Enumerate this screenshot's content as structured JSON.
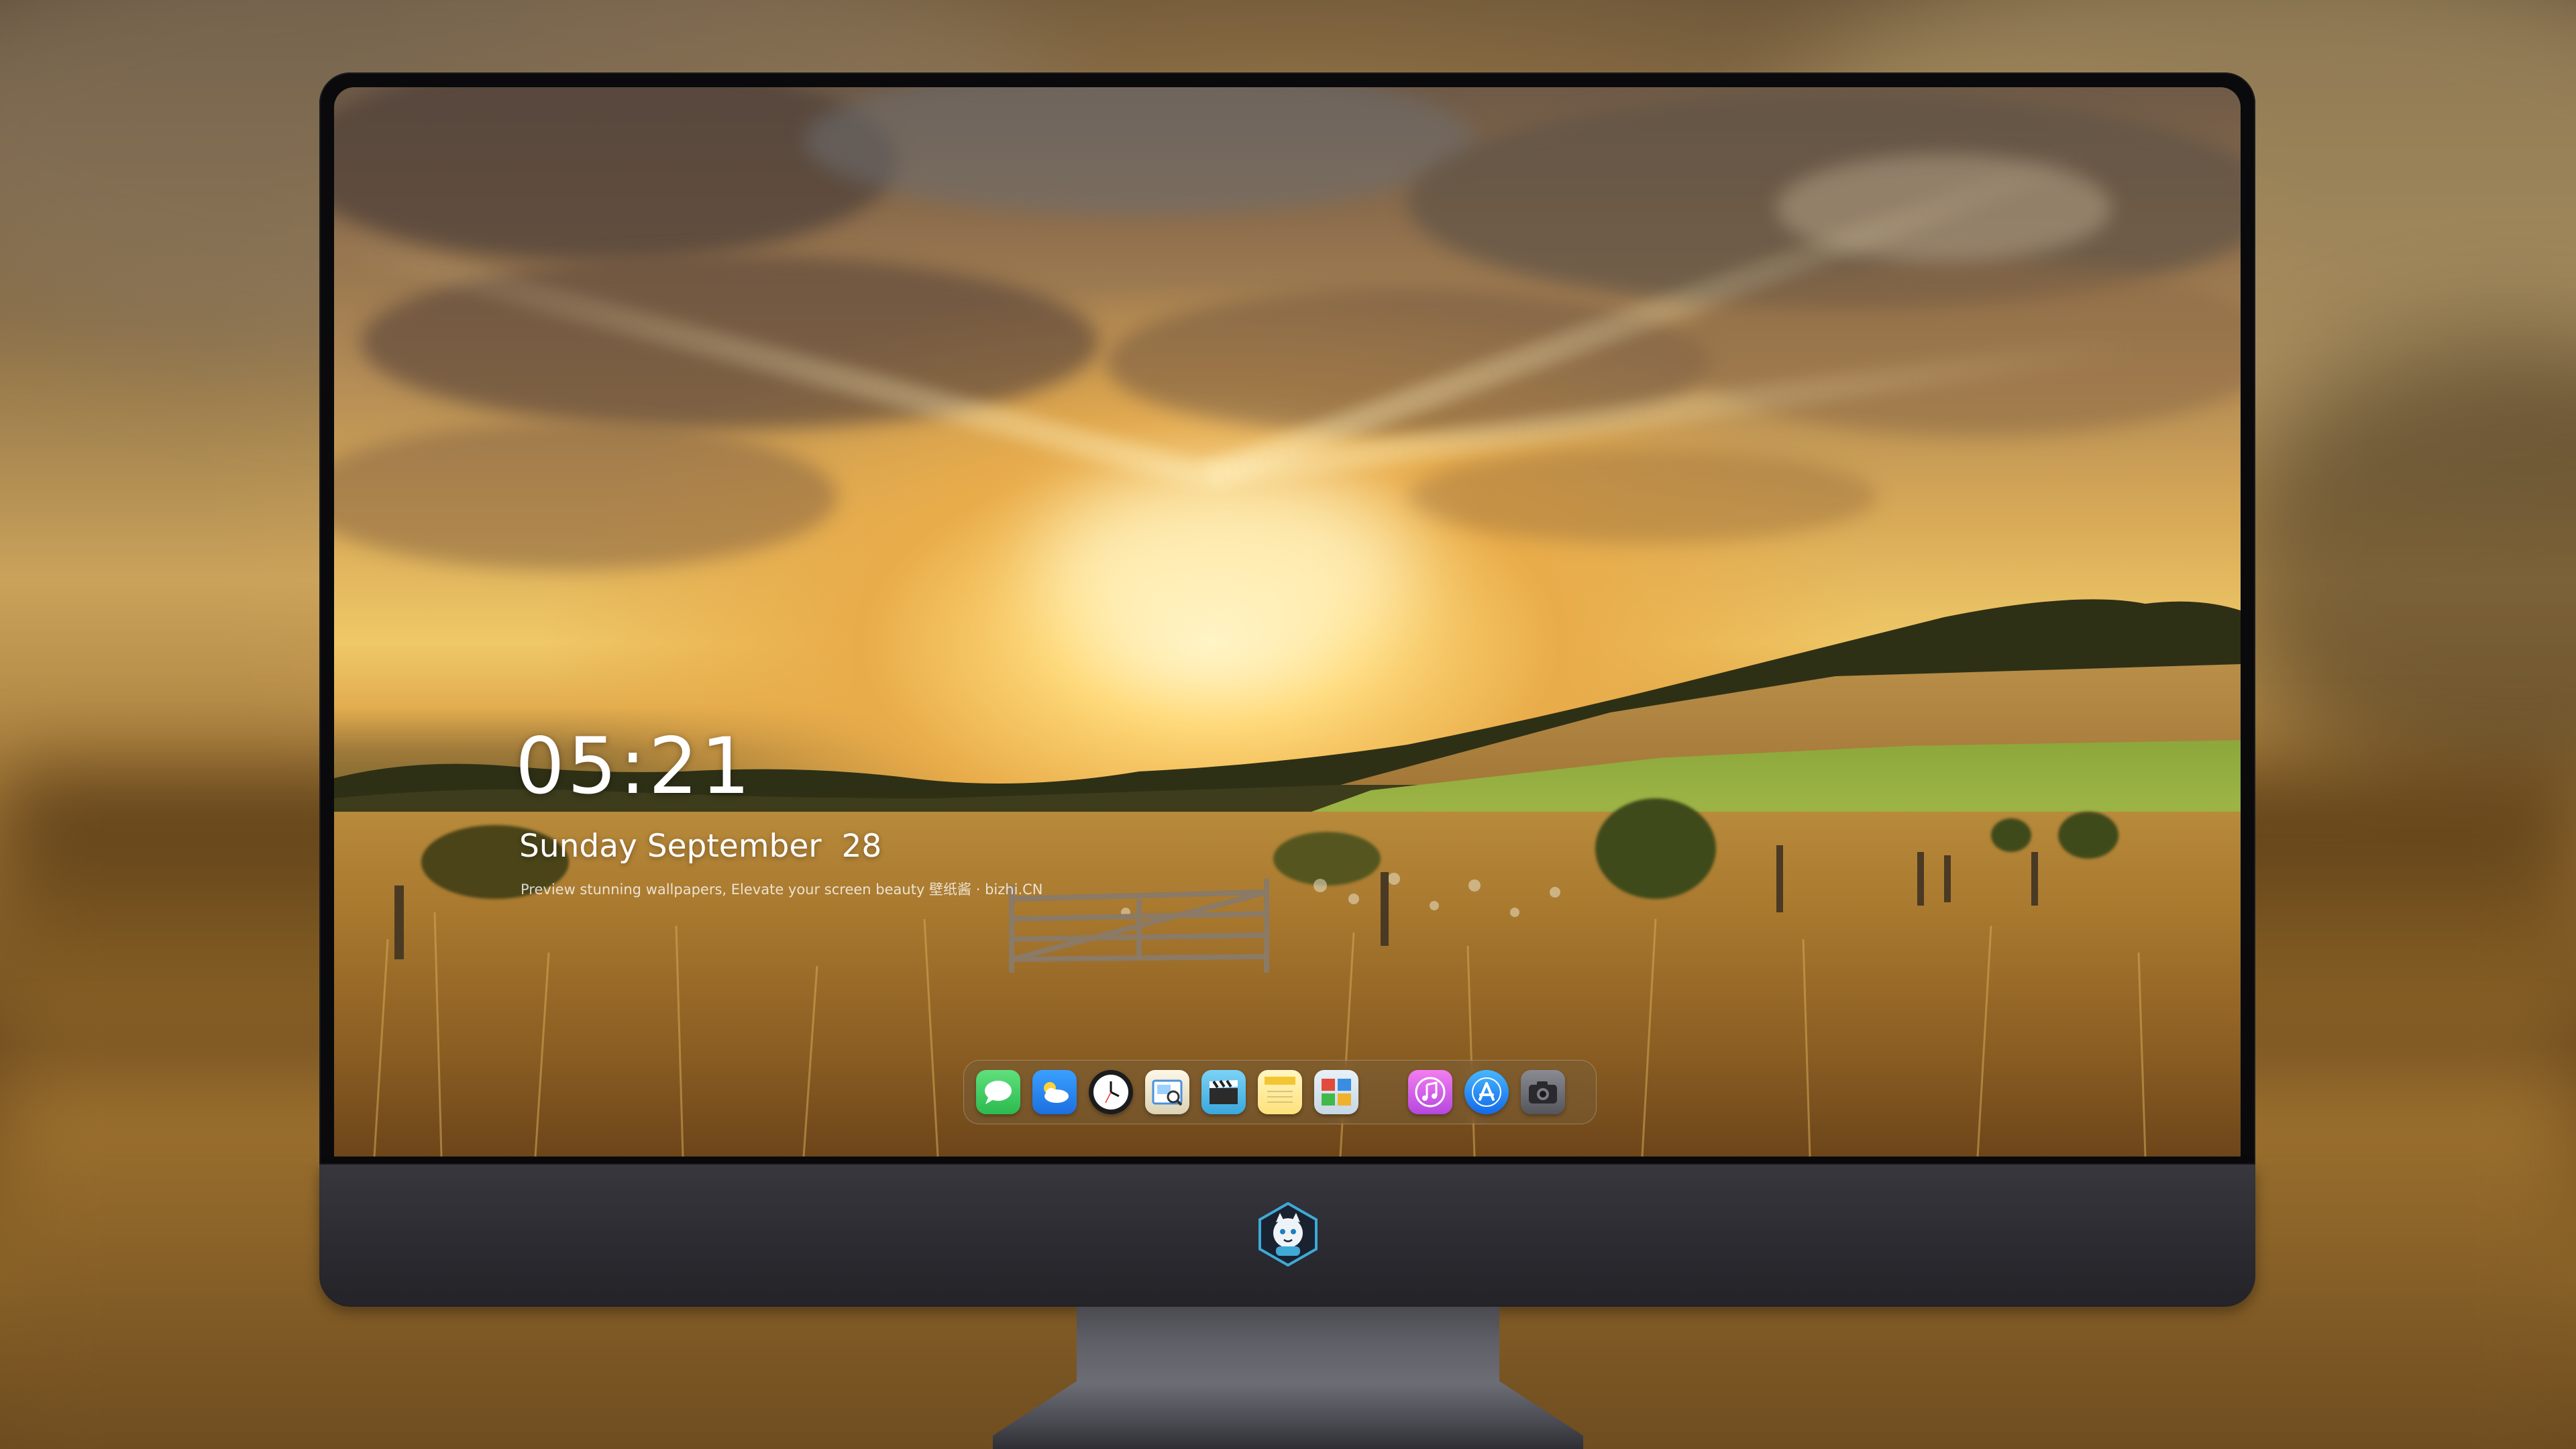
{
  "lock_screen": {
    "time": "05:21",
    "date": "Sunday September  28",
    "tagline": "Preview stunning wallpapers, Elevate your screen beauty  壁纸酱 · bizhi.CN"
  },
  "dock": {
    "apps": [
      {
        "name": "Messages",
        "icon": "messages-icon",
        "color": "#35c759"
      },
      {
        "name": "Weather",
        "icon": "weather-icon",
        "color": "#2f8ef0"
      },
      {
        "name": "Clock",
        "icon": "clock-icon",
        "color": "#f2f2f2"
      },
      {
        "name": "Preview",
        "icon": "preview-icon",
        "color": "#e8e2cf"
      },
      {
        "name": "Clips",
        "icon": "clapperboard-icon",
        "color": "#4fb6e8"
      },
      {
        "name": "Notes",
        "icon": "notes-icon",
        "color": "#ffd84a"
      },
      {
        "name": "Photo Booth",
        "icon": "photo-booth-icon",
        "color": "#d9e7f2"
      },
      {
        "name": "iTunes",
        "icon": "music-note-icon",
        "color": "#e85ad6"
      },
      {
        "name": "App Store",
        "icon": "app-store-icon",
        "color": "#1e8ff5"
      },
      {
        "name": "Camera",
        "icon": "camera-icon",
        "color": "#6a6a72"
      }
    ]
  },
  "brand": {
    "logo": "mascot-logo",
    "accent": "#3fa9d8"
  }
}
